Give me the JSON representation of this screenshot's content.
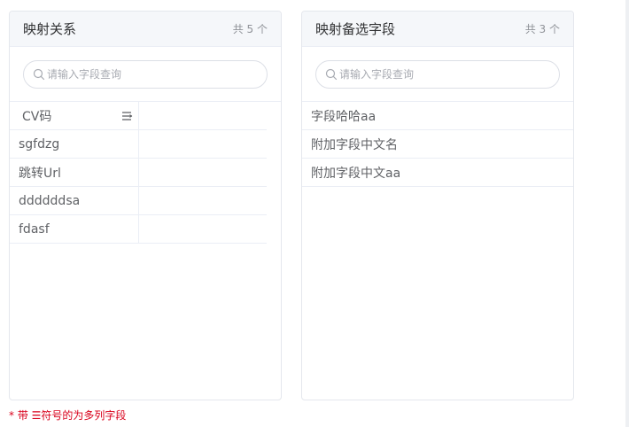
{
  "left_panel": {
    "title": "映射关系",
    "count": "共 5 个",
    "search_placeholder": "请输入字段查询",
    "table": {
      "header": "CV码",
      "rows": [
        "sgfdzg",
        "跳转Url",
        "ddddddsa",
        "fdasf"
      ]
    }
  },
  "right_panel": {
    "title": "映射备选字段",
    "count": "共 3 个",
    "search_placeholder": "请输入字段查询",
    "items": [
      "字段哈哈aa",
      "附加字段中文名",
      "附加字段中文aa"
    ]
  },
  "footnote": "* 带 ☰符号的为多列字段",
  "colors": {
    "accent_red": "#d9001b",
    "header_bg": "#f5f7fa",
    "border": "#e4e7ed"
  }
}
